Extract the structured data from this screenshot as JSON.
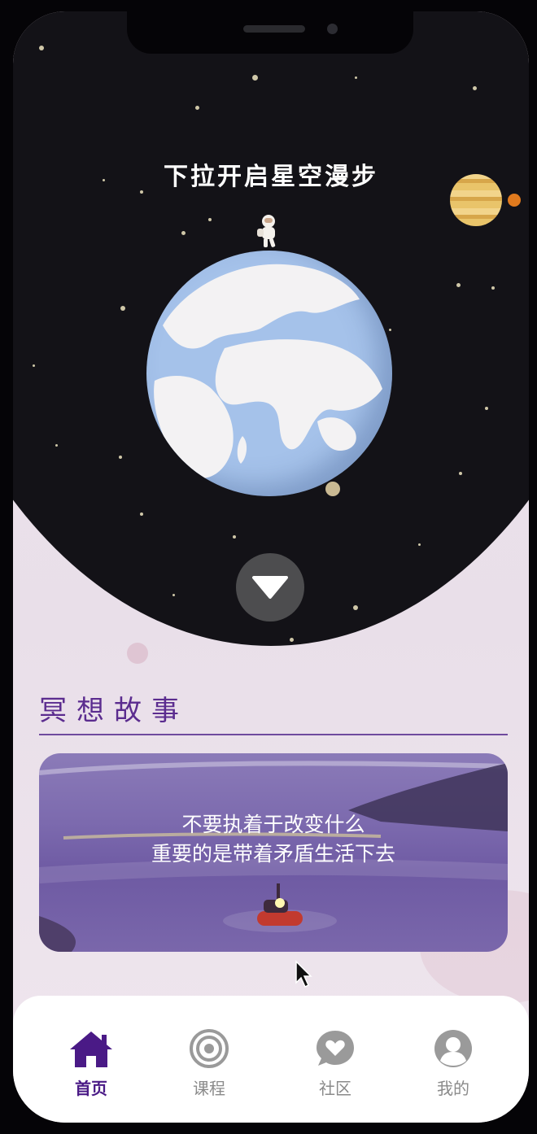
{
  "hero": {
    "pull_hint": "下拉开启星空漫步"
  },
  "section": {
    "title": "冥想故事"
  },
  "story_card": {
    "line1": "不要执着于改变什么",
    "line2": "重要的是带着矛盾生活下去"
  },
  "tabbar": {
    "items": [
      {
        "label": "首页",
        "icon": "home-icon",
        "active": true
      },
      {
        "label": "课程",
        "icon": "target-icon",
        "active": false
      },
      {
        "label": "社区",
        "icon": "heart-bubble-icon",
        "active": false
      },
      {
        "label": "我的",
        "icon": "user-icon",
        "active": false
      }
    ]
  },
  "colors": {
    "accent": "#4a1a86",
    "space": "#131217",
    "tab_inactive": "#8a8a8a"
  }
}
